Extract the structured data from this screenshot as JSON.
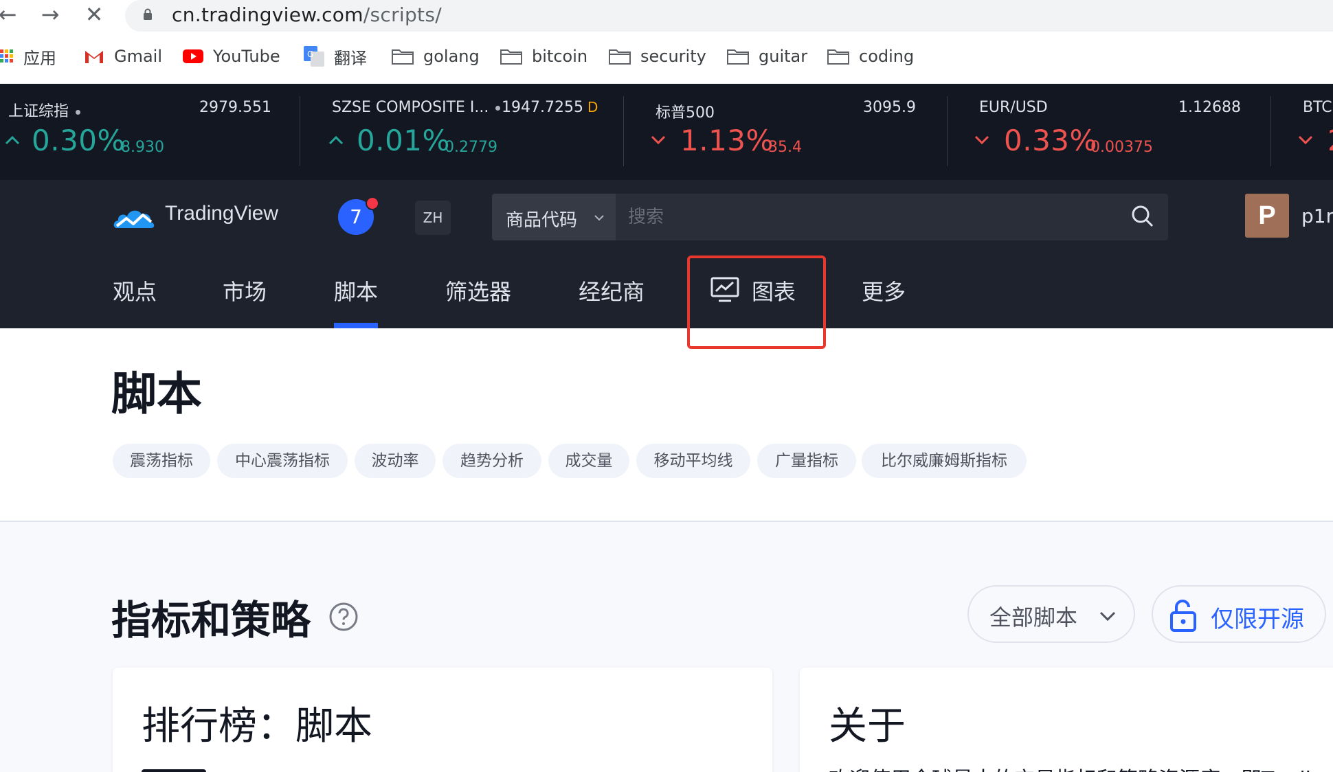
{
  "browser": {
    "url_host": "cn.tradingview.com",
    "url_path": "/scripts/",
    "bookmarks": [
      "应用",
      "Gmail",
      "YouTube",
      "翻译",
      "golang",
      "bitcoin",
      "security",
      "guitar",
      "coding"
    ]
  },
  "ticker": [
    {
      "name": "上证综指",
      "price": "2979.551",
      "price_suffix": "",
      "change_pct": "0.30%",
      "change_abs": "8.930",
      "direction": "up"
    },
    {
      "name": "SZSE COMPOSITE I...",
      "price": "1947.7255",
      "price_suffix": "D",
      "change_pct": "0.01%",
      "change_abs": "0.2779",
      "direction": "up"
    },
    {
      "name": "标普500",
      "price": "3095.9",
      "price_suffix": "",
      "change_pct": "1.13%",
      "change_abs": "35.4",
      "direction": "down"
    },
    {
      "name": "EUR/USD",
      "price": "1.12688",
      "price_suffix": "",
      "change_pct": "0.33%",
      "change_abs": "0.00375",
      "direction": "down"
    },
    {
      "name": "BTC",
      "price": "",
      "price_suffix": "",
      "change_pct": "2",
      "change_abs": "",
      "direction": "down"
    }
  ],
  "header": {
    "brand": "TradingView",
    "notifications": "7",
    "language": "ZH",
    "search_type": "商品代码",
    "search_placeholder": "搜索",
    "avatar_letter": "P",
    "username": "p1r"
  },
  "nav": {
    "items": [
      "观点",
      "市场",
      "脚本",
      "筛选器",
      "经纪商",
      "图表",
      "更多"
    ],
    "active": "脚本"
  },
  "page": {
    "title": "脚本",
    "tags": [
      "震荡指标",
      "中心震荡指标",
      "波动率",
      "趋势分析",
      "成交量",
      "移动平均线",
      "广量指标",
      "比尔威廉姆斯指标"
    ]
  },
  "scripts_section": {
    "title": "指标和策略",
    "filter_label": "全部脚本",
    "open_source_label": "仅限开源",
    "left_card_title": "排行榜：脚本",
    "right_card_title": "关于",
    "right_card_text": "欢迎使用全球最大的交易指标和策略资源库，即TradingV"
  },
  "colors": {
    "up": "#26a69a",
    "down": "#ef5350",
    "accent": "#2962ff",
    "highlight": "#e8372c",
    "header_bg": "#1e222d",
    "ticker_bg": "#131722"
  }
}
